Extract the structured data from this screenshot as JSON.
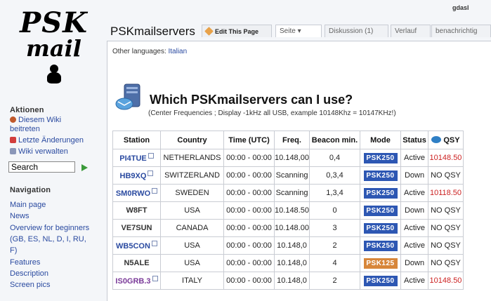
{
  "header": {
    "username": "gdasl",
    "page_title": "PSKmailservers",
    "tabs": [
      {
        "label": "Edit This Page"
      },
      {
        "label": "Seite ▾"
      },
      {
        "label": "Diskussion (1)"
      },
      {
        "label": "Verlauf"
      },
      {
        "label": "benachrichtig"
      }
    ]
  },
  "sidebar": {
    "logo_line1": "PSK",
    "logo_line2": "mail",
    "aktionen_title": "Aktionen",
    "aktionen_items": [
      {
        "label": "Diesem Wiki",
        "icon": "users-icon"
      },
      {
        "label": "beitreten"
      },
      {
        "label": "Letzte Änderungen",
        "icon": "calendar-icon"
      },
      {
        "label": "Wiki verwalten",
        "icon": "admin-icon"
      }
    ],
    "search_value": "Search",
    "navigation_title": "Navigation",
    "navigation_items": [
      {
        "label": "Main page"
      },
      {
        "label": "News"
      },
      {
        "label": "Overview for beginners"
      },
      {
        "label": "(GB, ES, NL, D, I, RU,"
      },
      {
        "label": "F)"
      },
      {
        "label": "Features"
      },
      {
        "label": "Description"
      },
      {
        "label": "Screen pics"
      }
    ]
  },
  "content": {
    "other_languages_label": "Other languages:",
    "other_languages_link": "Italian",
    "heading": "Which PSKmailservers can I use?",
    "subheading": "(Center Frequencies ; Display -1kHz all USB, example 10148Khz = 10147KHz!)"
  },
  "table": {
    "headers": [
      "Station",
      "Country",
      "Time (UTC)",
      "Freq.",
      "Beacon min.",
      "Mode",
      "Status",
      "QSY"
    ],
    "rows": [
      {
        "station": "PI4TUE",
        "country": "NETHERLANDS",
        "time": "00:00 - 00:00",
        "freq": "10.148,00",
        "beacon": "0,4",
        "mode": "PSK250",
        "status": "Active",
        "qsy": "10148.50"
      },
      {
        "station": "HB9XQ",
        "country": "SWITZERLAND",
        "time": "00:00 - 00:00",
        "freq": "Scanning",
        "beacon": "0,3,4",
        "mode": "PSK250",
        "status": "Down",
        "qsy": "NO QSY"
      },
      {
        "station": "SM0RWO",
        "country": "SWEDEN",
        "time": "00:00 - 00:00",
        "freq": "Scanning",
        "beacon": "1,3,4",
        "mode": "PSK250",
        "status": "Active",
        "qsy": "10118.50"
      },
      {
        "station": "W8FT",
        "country": "USA",
        "time": "00:00 - 00:00",
        "freq": "10.148.50",
        "beacon": "0",
        "mode": "PSK250",
        "status": "Down",
        "qsy": "NO QSY"
      },
      {
        "station": "VE7SUN",
        "country": "CANADA",
        "time": "00:00 - 00:00",
        "freq": "10.148.00",
        "beacon": "3",
        "mode": "PSK250",
        "status": "Active",
        "qsy": "NO QSY"
      },
      {
        "station": "WB5CON",
        "country": "USA",
        "time": "00:00 - 00:00",
        "freq": "10.148,0",
        "beacon": "2",
        "mode": "PSK250",
        "status": "Active",
        "qsy": "NO QSY"
      },
      {
        "station": "N5ALE",
        "country": "USA",
        "time": "00:00 - 00:00",
        "freq": "10.148,0",
        "beacon": "4",
        "mode": "PSK125",
        "status": "Down",
        "qsy": "NO QSY"
      },
      {
        "station": "IS0GRB.3",
        "country": "ITALY",
        "time": "00:00 - 00:00",
        "freq": "10.148,0",
        "beacon": "2",
        "mode": "PSK250",
        "status": "Active",
        "qsy": "10148.50"
      }
    ]
  },
  "colors": {
    "link": "#2a4aa0",
    "visited": "#7a3a99",
    "qsy_red": "#cc2222",
    "mode_psk250": "#2d57b3",
    "mode_psk125": "#d7863a"
  }
}
